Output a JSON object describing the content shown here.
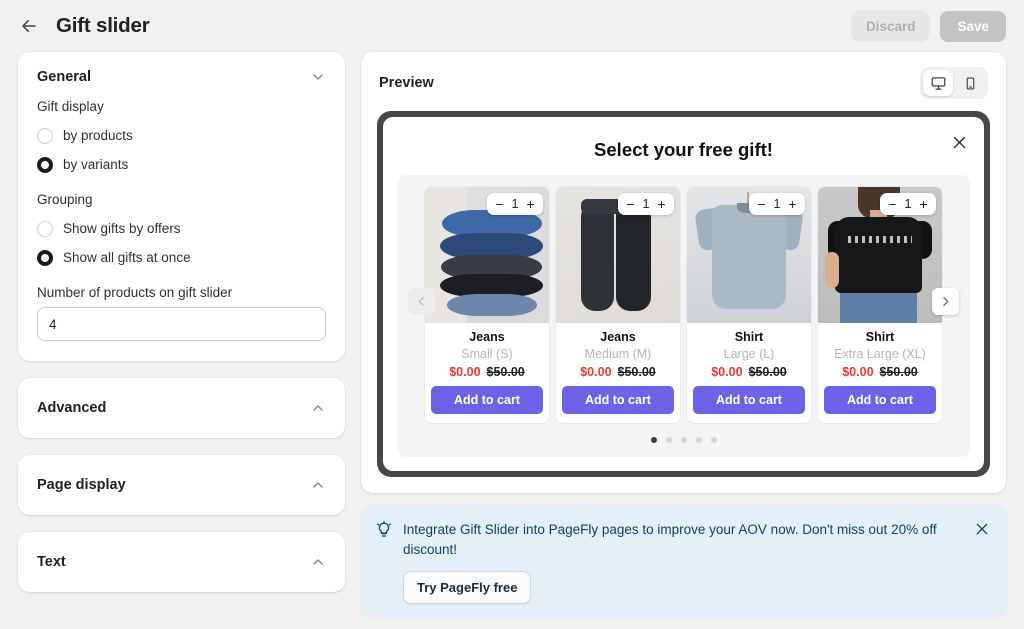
{
  "topbar": {
    "back_icon": "arrow-left-icon",
    "title": "Gift slider",
    "discard_label": "Discard",
    "save_label": "Save"
  },
  "sidebar": {
    "general": {
      "title": "General",
      "chevron": "chevron-down-icon",
      "gift_display_label": "Gift display",
      "gift_display_options": [
        {
          "label": "by products",
          "selected": false
        },
        {
          "label": "by variants",
          "selected": true
        }
      ],
      "grouping_label": "Grouping",
      "grouping_options": [
        {
          "label": "Show gifts by offers",
          "selected": false
        },
        {
          "label": "Show all gifts at once",
          "selected": true
        }
      ],
      "number_label": "Number of products on gift slider",
      "number_value": "4"
    },
    "sections": [
      {
        "title": "Advanced",
        "chevron": "chevron-up-icon"
      },
      {
        "title": "Page display",
        "chevron": "chevron-up-icon"
      },
      {
        "title": "Text",
        "chevron": "chevron-up-icon"
      }
    ]
  },
  "preview": {
    "title": "Preview",
    "devices": [
      {
        "name": "desktop-view-button",
        "icon": "desktop-icon",
        "active": true
      },
      {
        "name": "mobile-view-button",
        "icon": "mobile-icon",
        "active": false
      }
    ],
    "modal": {
      "title": "Select your free gift!",
      "close_icon": "close-icon",
      "prev_label": "‹",
      "next_label": "›",
      "products": [
        {
          "name": "Jeans",
          "variant": "Small (S)",
          "price_new": "$0.00",
          "price_old": "$50.00",
          "qty": "1",
          "minus": "−",
          "plus": "+",
          "add_label": "Add to cart",
          "art": "jeans-stack"
        },
        {
          "name": "Jeans",
          "variant": "Medium (M)",
          "price_new": "$0.00",
          "price_old": "$50.00",
          "qty": "1",
          "minus": "−",
          "plus": "+",
          "add_label": "Add to cart",
          "art": "pants"
        },
        {
          "name": "Shirt",
          "variant": "Large (L)",
          "price_new": "$0.00",
          "price_old": "$50.00",
          "qty": "1",
          "minus": "−",
          "plus": "+",
          "add_label": "Add to cart",
          "art": "tee-grey"
        },
        {
          "name": "Shirt",
          "variant": "Extra Large (XL)",
          "price_new": "$0.00",
          "price_old": "$50.00",
          "qty": "1",
          "minus": "−",
          "plus": "+",
          "add_label": "Add to cart",
          "art": "tee-black"
        }
      ],
      "dots": [
        true,
        false,
        false,
        false,
        false
      ]
    }
  },
  "banner": {
    "icon": "lightbulb-icon",
    "text": "Integrate Gift Slider into PageFly pages to improve your AOV now. Don't miss out 20% off discount!",
    "button_label": "Try PageFly free",
    "close_icon": "close-icon"
  },
  "colors": {
    "accent_purple": "#6c63e8",
    "price_red": "#e8392f",
    "banner_bg": "#e4eff8",
    "banner_text": "#14425c",
    "modal_frame": "#474747"
  }
}
